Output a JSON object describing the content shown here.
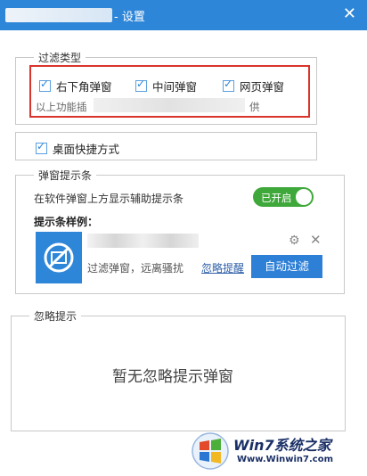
{
  "window": {
    "title": "- 设置",
    "close_icon": "close-icon"
  },
  "filter_group": {
    "legend": "过滤类型",
    "checkboxes": [
      {
        "label": "右下角弹窗",
        "checked": true
      },
      {
        "label": "中间弹窗",
        "checked": true
      },
      {
        "label": "网页弹窗",
        "checked": true
      }
    ],
    "note_prefix": "以上功能插",
    "note_suffix": "供"
  },
  "desktop_shortcut": {
    "label": "桌面快捷方式",
    "checked": true
  },
  "popup_tip_group": {
    "legend": "弹窗提示条",
    "description": "在软件弹窗上方显示辅助提示条",
    "toggle_label": "已开启",
    "sample_label": "提示条样例：",
    "sample": {
      "desc": "过滤弹窗，远离骚扰",
      "ignore_link": "忽略提醒",
      "auto_button": "自动过滤"
    }
  },
  "ignore_group": {
    "legend": "忽略提示",
    "empty_message": "暂无忽略提示弹窗"
  },
  "watermark": {
    "text": "Win7系统之家",
    "url": "Www.Winwin7.com"
  },
  "colors": {
    "title_bar": "#2e86d8",
    "highlight": "#d9342b",
    "toggle_on": "#3fa83a",
    "button": "#2e7fd6"
  }
}
